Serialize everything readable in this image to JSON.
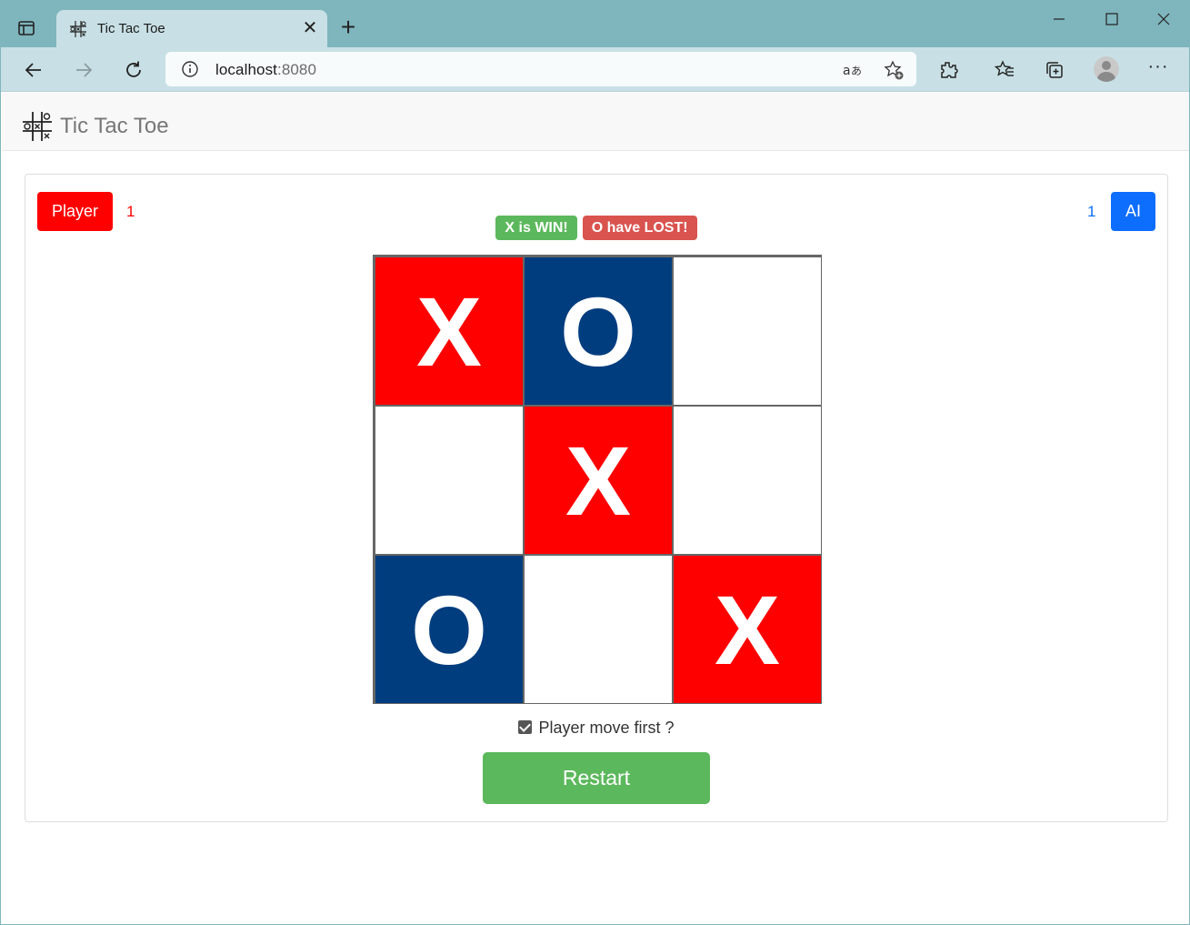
{
  "browser": {
    "tab": {
      "title": "Tic Tac Toe",
      "favicon": "tic-tac-toe-icon",
      "close_glyph": "✕"
    },
    "new_tab_glyph": "+",
    "address": {
      "host": "localhost",
      "port": ":8080"
    },
    "icons": [
      "tab-actions-icon",
      "back-icon",
      "forward-icon",
      "refresh-icon",
      "info-icon",
      "read-aloud-icon",
      "add-favorite-icon",
      "extensions-icon",
      "favorites-icon",
      "collections-icon",
      "profile-icon",
      "more-icon"
    ],
    "more_glyph": "···"
  },
  "navbar": {
    "brand": "Tic Tac Toe",
    "logo": "tic-tac-toe-icon"
  },
  "game": {
    "player": {
      "label": "Player",
      "score": "1",
      "color": "#ff0000"
    },
    "ai": {
      "label": "AI",
      "score": "1",
      "color": "#0d6efd"
    },
    "status": {
      "win": "X is WIN!",
      "lost": "O have LOST!"
    },
    "board": [
      [
        "X",
        "O",
        ""
      ],
      [
        "",
        "X",
        ""
      ],
      [
        "O",
        "",
        "X"
      ]
    ],
    "colors": {
      "x": "#ff0000",
      "o": "#003d7e"
    },
    "player_first": {
      "label": "Player move first ?",
      "checked": true
    },
    "restart_label": "Restart"
  }
}
